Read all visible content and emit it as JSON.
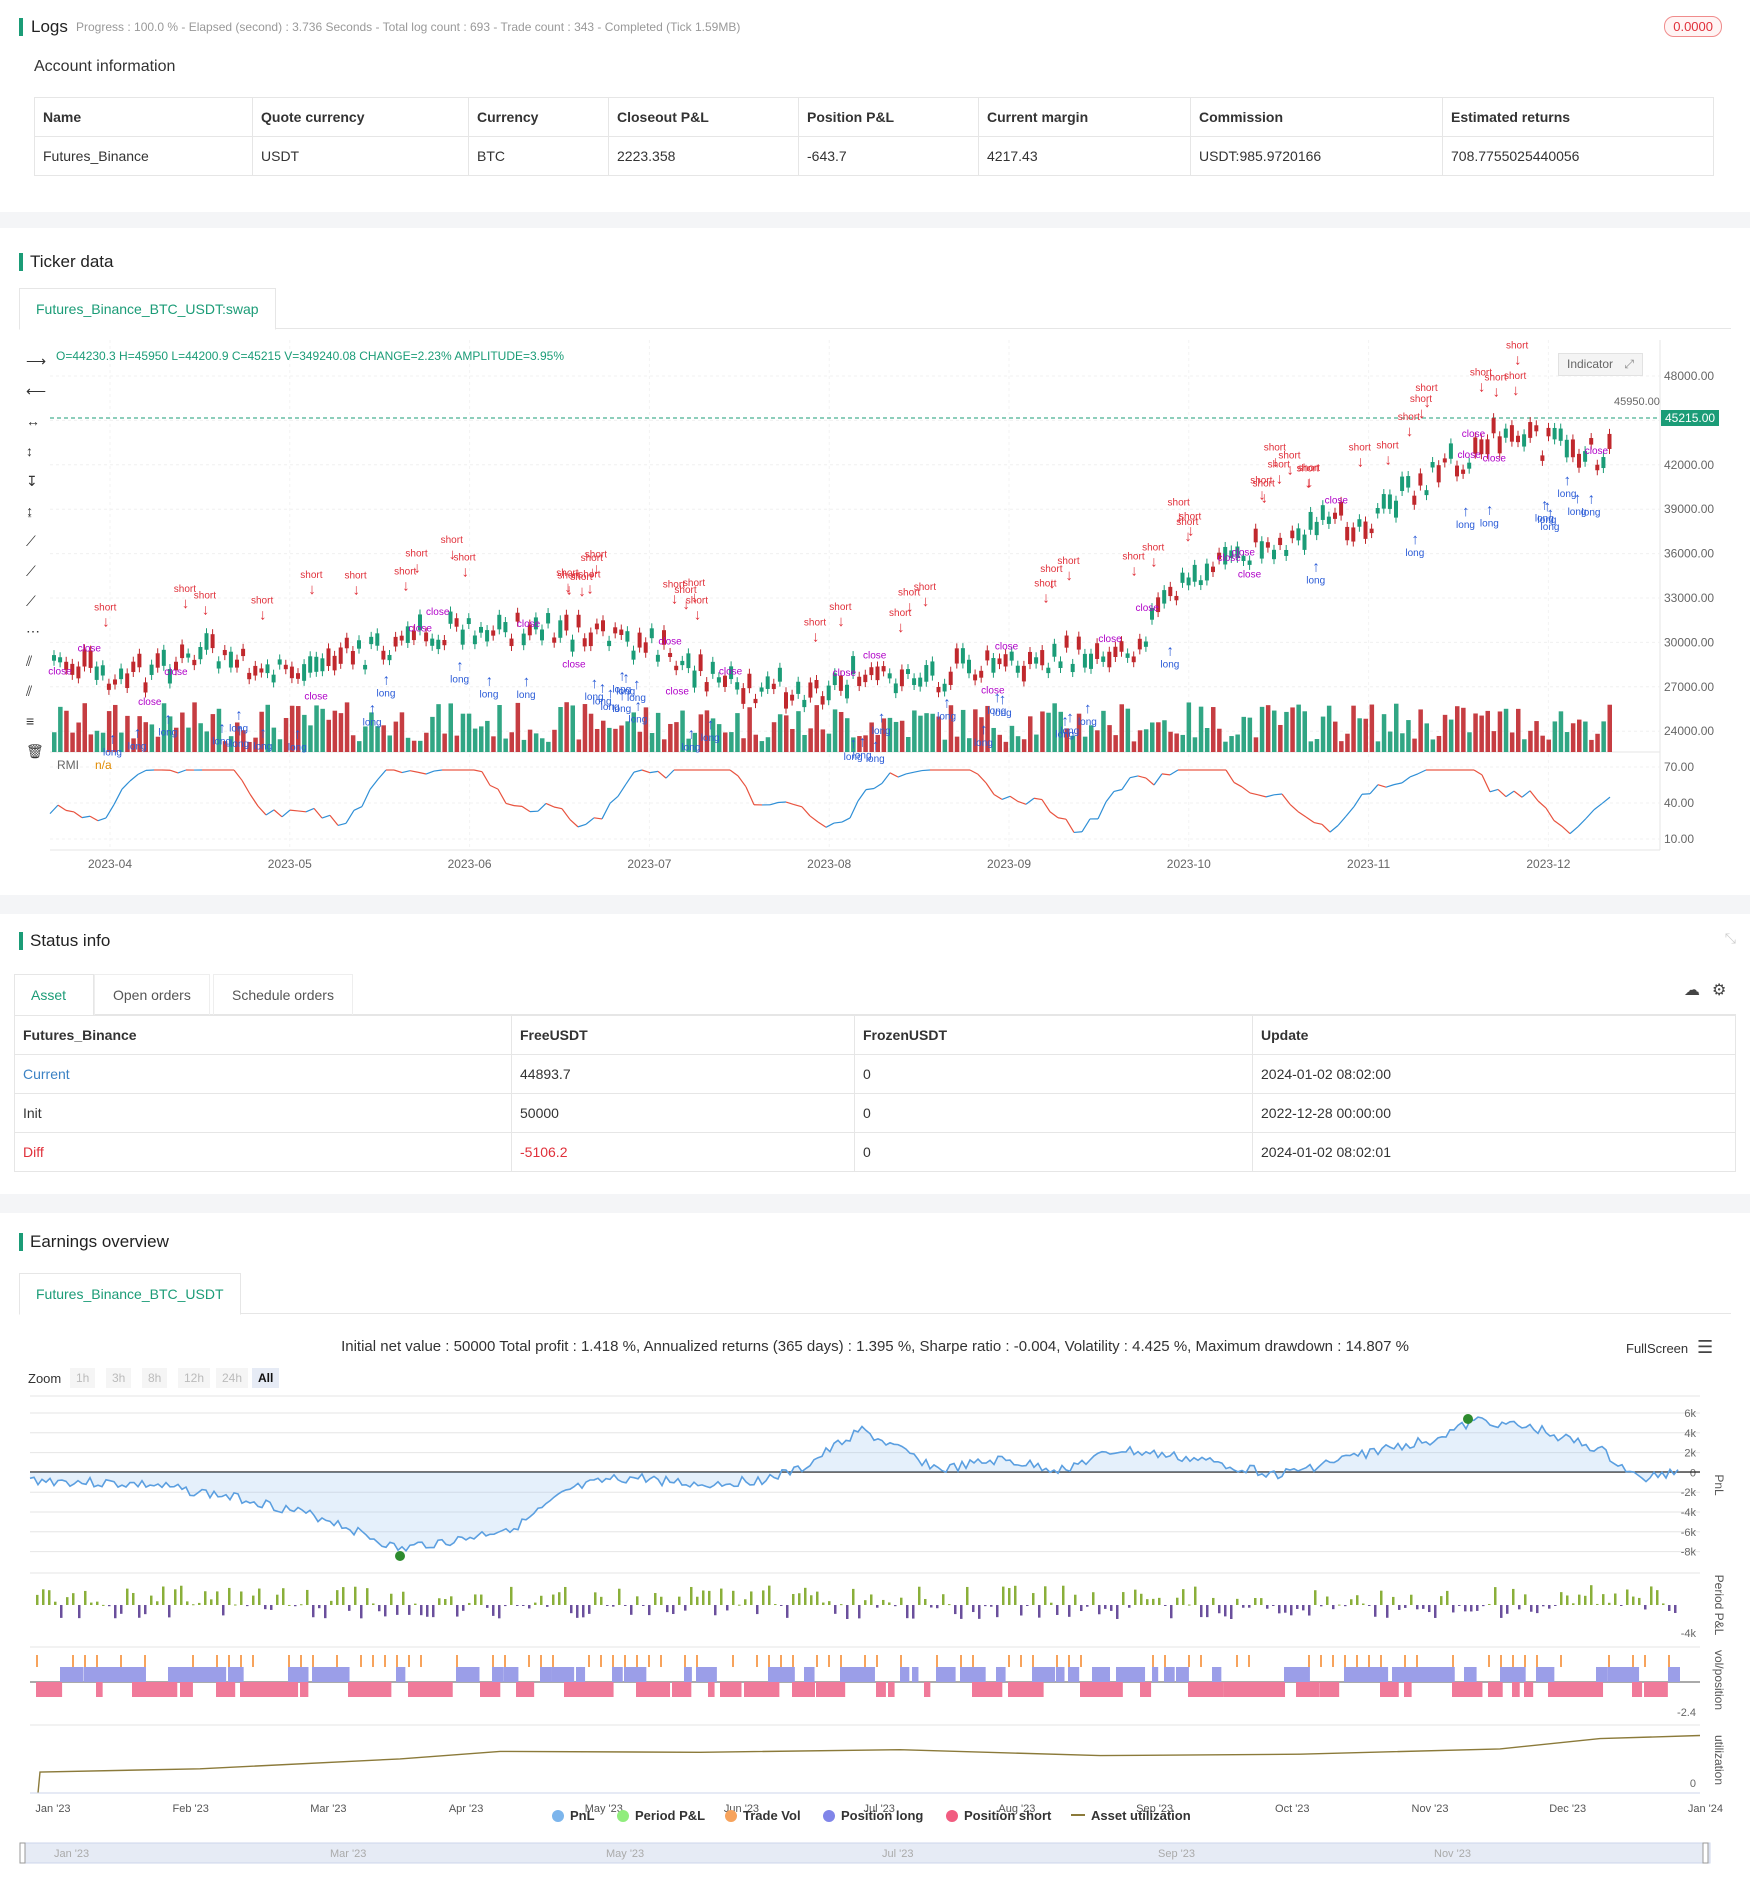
{
  "logs": {
    "title": "Logs",
    "meta": "Progress : 100.0 % - Elapsed (second) : 3.736  Seconds - Total log count : 693 - Trade count : 343 - Completed (Tick 1.59MB)",
    "badge": "0.0000",
    "account_title": "Account information",
    "headers": [
      "Name",
      "Quote currency",
      "Currency",
      "Closeout P&L",
      "Position P&L",
      "Current margin",
      "Commission",
      "Estimated returns"
    ],
    "row": [
      "Futures_Binance",
      "USDT",
      "BTC",
      "2223.358",
      "-643.7",
      "4217.43",
      "USDT:985.9720166",
      "708.7755025440056"
    ]
  },
  "ticker": {
    "title": "Ticker data",
    "tab": "Futures_Binance_BTC_USDT:swap",
    "ohlc": "O=44230.3 H=45950 L=44200.9 C=45215 V=349240.08 CHANGE=2.23% AMPLITUDE=3.95%",
    "indicator_btn": "Indicator",
    "last_price": "45215.00",
    "high_label": "45950.00",
    "y_ticks": [
      "48000.00",
      "45000.00",
      "42000.00",
      "39000.00",
      "36000.00",
      "33000.00",
      "30000.00",
      "27000.00",
      "24000.00"
    ],
    "rmi_label": "RMI",
    "rmi_value": "n/a",
    "rmi_ticks": [
      "70.00",
      "40.00",
      "10.00"
    ],
    "x_ticks": [
      "2023-04",
      "2023-05",
      "2023-06",
      "2023-07",
      "2023-08",
      "2023-09",
      "2023-10",
      "2023-11",
      "2023-12"
    ],
    "colors": {
      "up": "#1b9c77",
      "down": "#c0282d",
      "short": "#e0303a",
      "long": "#2a5bd7",
      "close": "#b000c8"
    }
  },
  "status": {
    "title": "Status info",
    "tabs": [
      "Asset",
      "Open orders",
      "Schedule orders"
    ],
    "headers": [
      "Futures_Binance",
      "FreeUSDT",
      "FrozenUSDT",
      "Update"
    ],
    "rows": [
      [
        "Current",
        "44893.7",
        "0",
        "2024-01-02 08:02:00"
      ],
      [
        "Init",
        "50000",
        "0",
        "2022-12-28 00:00:00"
      ],
      [
        "Diff",
        "-5106.2",
        "0",
        "2024-01-02 08:02:01"
      ]
    ]
  },
  "earnings": {
    "title": "Earnings overview",
    "tab": "Futures_Binance_BTC_USDT",
    "summary": "Initial net value : 50000 Total profit : 1.418 %, Annualized returns (365 days) : 1.395 %, Sharpe ratio : -0.004, Volatility : 4.425 %, Maximum drawdown : 14.807 %",
    "fullscreen": "FullScreen",
    "zoom_label": "Zoom",
    "zoom_options": [
      "1h",
      "3h",
      "8h",
      "12h",
      "24h",
      "All"
    ],
    "pnl_ticks": [
      "6k",
      "4k",
      "2k",
      "0",
      "-2k",
      "-4k",
      "-6k",
      "-8k"
    ],
    "period_tick": "-4k",
    "vol_tick": "-2.4",
    "util_tick": "0",
    "axis_labels": [
      "PnL",
      "Period P&L",
      "vol/position",
      "utilization"
    ],
    "x_ticks": [
      "Jan '23",
      "Feb '23",
      "Mar '23",
      "Apr '23",
      "May '23",
      "Jun '23",
      "Jul '23",
      "Aug '23",
      "Sep '23",
      "Oct '23",
      "Nov '23",
      "Dec '23",
      "Jan '24"
    ],
    "nav_ticks": [
      "Jan '23",
      "Mar '23",
      "May '23",
      "Jul '23",
      "Sep '23",
      "Nov '23"
    ],
    "legend": [
      {
        "label": "PnL",
        "color": "#7cb5ec"
      },
      {
        "label": "Period P&L",
        "color": "#90ed7d"
      },
      {
        "label": "Trade Vol",
        "color": "#f7a35c"
      },
      {
        "label": "Position long",
        "color": "#8085e9"
      },
      {
        "label": "Position short",
        "color": "#f15c80"
      },
      {
        "label": "Asset utilization",
        "color": "#8b7a3a"
      }
    ]
  }
}
